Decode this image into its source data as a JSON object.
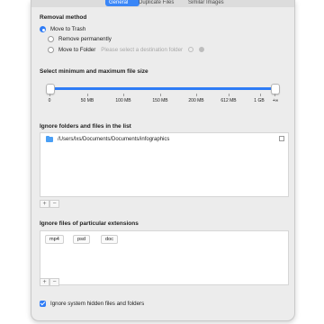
{
  "tabs": [
    {
      "label": "General",
      "active": true
    },
    {
      "label": "Duplicate Files",
      "active": false
    },
    {
      "label": "Similar Images",
      "active": false
    }
  ],
  "removal": {
    "title": "Removal method",
    "options": [
      {
        "label": "Move to Trash",
        "checked": true
      },
      {
        "label": "Remove permanently",
        "checked": false
      },
      {
        "label": "Move to Folder",
        "checked": false
      }
    ],
    "folder_placeholder": "Please select a destination folder"
  },
  "size_filter": {
    "title": "Select minimum and maximum file size",
    "min_value": "0",
    "max_value": "+∞",
    "ticks": [
      "0",
      "50 MB",
      "100 MB",
      "150 MB",
      "200 MB",
      "612 MB",
      "1 GB",
      "+∞"
    ]
  },
  "ignore_folders": {
    "title": "Ignore folders and files in the list",
    "items": [
      "/Users/lxs/Documents/Documents/infographics"
    ]
  },
  "ignore_extensions": {
    "title": "Ignore files of particular extensions",
    "items": [
      "mp4",
      "psd",
      "doc"
    ]
  },
  "buttons": {
    "add": "+",
    "remove": "−"
  },
  "hidden_files": {
    "label": "Ignore system hidden files and folders",
    "checked": true
  },
  "colors": {
    "accent": "#2f7cf6",
    "folder": "#4a9ff5"
  }
}
